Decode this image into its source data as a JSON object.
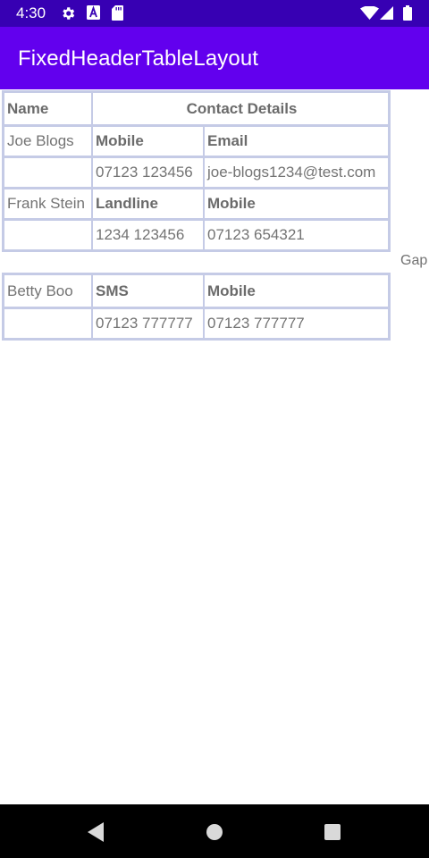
{
  "status_bar": {
    "time": "4:30",
    "icons": [
      "gear-icon",
      "text-a-icon",
      "sd-card-icon",
      "wifi-icon",
      "signal-icon",
      "battery-icon"
    ]
  },
  "app_bar": {
    "title": "FixedHeaderTableLayout"
  },
  "table": {
    "header": {
      "name": "Name",
      "details": "Contact Details"
    },
    "contacts": [
      {
        "name": "Joe Blogs",
        "label_1": "Mobile",
        "label_2": "Email",
        "value_1": "07123 123456",
        "value_2": "joe-blogs1234@test.com"
      },
      {
        "name": "Frank Stein",
        "label_1": "Landline",
        "label_2": "Mobile",
        "value_1": "1234 123456",
        "value_2": "07123 654321"
      },
      {
        "name": "Betty Boo",
        "label_1": "SMS",
        "label_2": "Mobile",
        "value_1": "07123 777777",
        "value_2": "07123 777777"
      }
    ]
  },
  "gap_label": "Gap",
  "nav_bar": {
    "icons": [
      "back-icon",
      "home-icon",
      "recents-icon"
    ]
  },
  "colors": {
    "status_bar": "#3700b3",
    "app_bar": "#6200ee",
    "table_border": "#c5cbe6",
    "cell_text": "#737373"
  }
}
